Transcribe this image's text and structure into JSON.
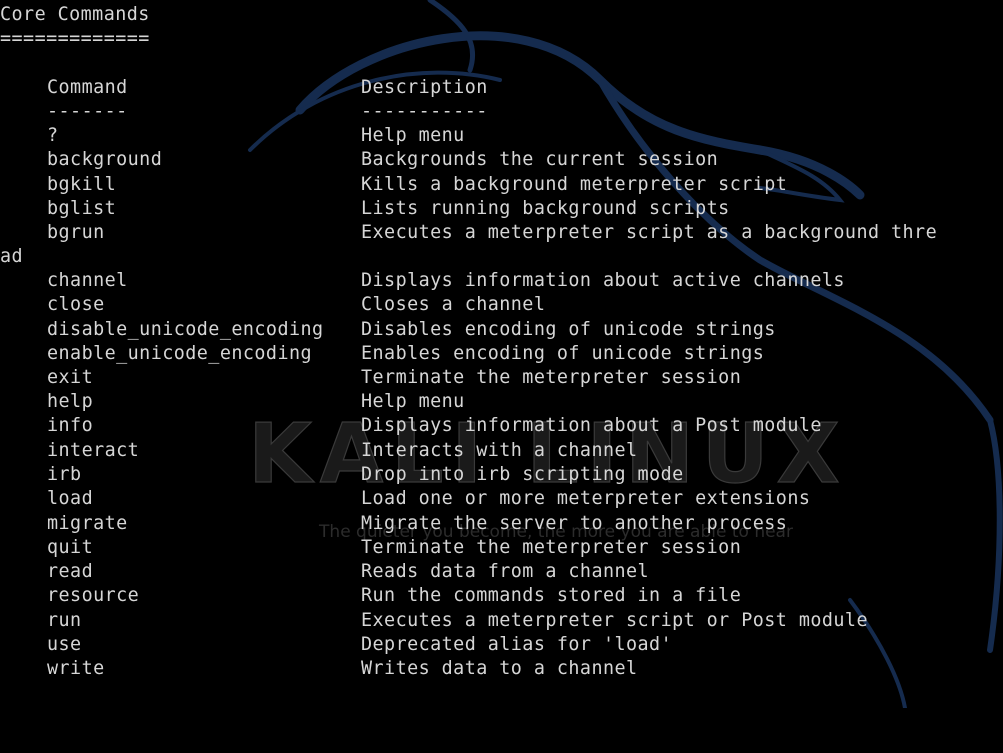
{
  "terminal": {
    "section_title": "Core Commands",
    "section_underline": "=============",
    "header": {
      "command": "Command",
      "description": "Description"
    },
    "separator": {
      "command": "-------",
      "description": "-----------"
    },
    "rows": [
      {
        "command": "?",
        "description": "Help menu"
      },
      {
        "command": "background",
        "description": "Backgrounds the current session"
      },
      {
        "command": "bgkill",
        "description": "Kills a background meterpreter script"
      },
      {
        "command": "bglist",
        "description": "Lists running background scripts"
      },
      {
        "command": "bgrun",
        "description": "Executes a meterpreter script as a background thre"
      },
      {
        "command": "channel",
        "description": "Displays information about active channels"
      },
      {
        "command": "close",
        "description": "Closes a channel"
      },
      {
        "command": "disable_unicode_encoding",
        "description": "Disables encoding of unicode strings"
      },
      {
        "command": "enable_unicode_encoding",
        "description": "Enables encoding of unicode strings"
      },
      {
        "command": "exit",
        "description": "Terminate the meterpreter session"
      },
      {
        "command": "help",
        "description": "Help menu"
      },
      {
        "command": "info",
        "description": "Displays information about a Post module"
      },
      {
        "command": "interact",
        "description": "Interacts with a channel"
      },
      {
        "command": "irb",
        "description": "Drop into irb scripting mode"
      },
      {
        "command": "load",
        "description": "Load one or more meterpreter extensions"
      },
      {
        "command": "migrate",
        "description": "Migrate the server to another process"
      },
      {
        "command": "quit",
        "description": "Terminate the meterpreter session"
      },
      {
        "command": "read",
        "description": "Reads data from a channel"
      },
      {
        "command": "resource",
        "description": "Run the commands stored in a file"
      },
      {
        "command": "run",
        "description": "Executes a meterpreter script or Post module"
      },
      {
        "command": "use",
        "description": "Deprecated alias for 'load'"
      },
      {
        "command": "write",
        "description": "Writes data to a channel"
      }
    ],
    "wrapped_tail": "ad"
  },
  "wallpaper": {
    "logo_text": "KALI LINUX",
    "tagline": "The quieter you become, the more you are able to hear",
    "dragon_icon": "kali-dragon-icon"
  },
  "colors": {
    "background": "#000000",
    "text": "#d6d6d6",
    "wallpaper_accent": "#1a3a66"
  }
}
